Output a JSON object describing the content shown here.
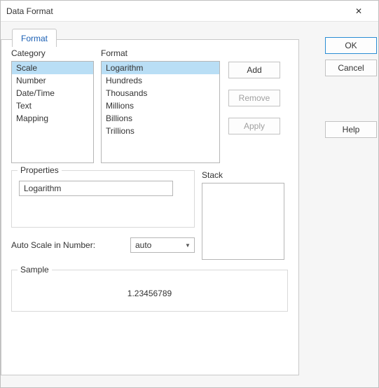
{
  "window": {
    "title": "Data Format",
    "close_glyph": "✕"
  },
  "tabs": {
    "format": "Format"
  },
  "labels": {
    "category": "Category",
    "format": "Format",
    "properties": "Properties",
    "stack": "Stack",
    "autoscale": "Auto Scale in Number:",
    "sample": "Sample"
  },
  "category_items": [
    "Scale",
    "Number",
    "Date/Time",
    "Text",
    "Mapping"
  ],
  "category_selected": 0,
  "format_items": [
    "Logarithm",
    "Hundreds",
    "Thousands",
    "Millions",
    "Billions",
    "Trillions"
  ],
  "format_selected": 0,
  "action_buttons": {
    "add": "Add",
    "remove": "Remove",
    "apply": "Apply"
  },
  "properties": {
    "value": "Logarithm"
  },
  "autoscale": {
    "value": "auto"
  },
  "sample": {
    "value": "1.23456789"
  },
  "dialog_buttons": {
    "ok": "OK",
    "cancel": "Cancel",
    "help": "Help"
  }
}
